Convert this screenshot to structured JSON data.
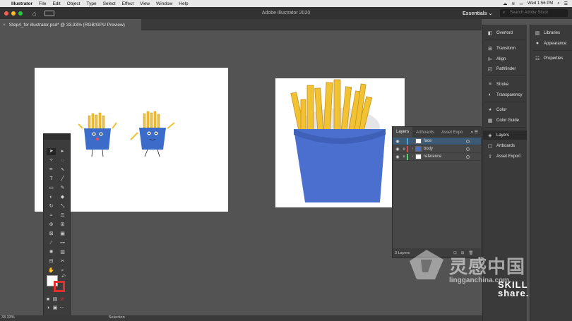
{
  "menubar": {
    "app": "Illustrator",
    "items": [
      "File",
      "Edit",
      "Object",
      "Type",
      "Select",
      "Effect",
      "View",
      "Window",
      "Help"
    ],
    "clock": "Wed 1:56 PM"
  },
  "appbar": {
    "title": "Adobe Illustrator 2020",
    "workspace": "Essentials",
    "search_placeholder": "Search Adobe Stock"
  },
  "document": {
    "tab": "Step4_for illustrator.psd* @ 33.33% (RGB/GPU Preview)"
  },
  "layers_panel": {
    "tabs": [
      "Layers",
      "Artboards",
      "Asset Expo"
    ],
    "layers": [
      {
        "name": "face",
        "color": "#4aa3d8",
        "selected": true,
        "locked": false
      },
      {
        "name": "body",
        "color": "#d84a4a",
        "selected": false,
        "locked": true
      },
      {
        "name": "reference",
        "color": "#4ad86a",
        "selected": false,
        "locked": true
      }
    ],
    "count": "3 Layers"
  },
  "dock": {
    "col1": [
      {
        "label": "Overlord",
        "icon": "overlord-icon"
      },
      {
        "label": "Transform",
        "icon": "transform-icon"
      },
      {
        "label": "Align",
        "icon": "align-icon"
      },
      {
        "label": "Pathfinder",
        "icon": "pathfinder-icon"
      },
      {
        "label": "Stroke",
        "icon": "stroke-icon"
      },
      {
        "label": "Transparency",
        "icon": "transparency-icon"
      },
      {
        "label": "Color",
        "icon": "color-icon"
      },
      {
        "label": "Color Guide",
        "icon": "color-guide-icon"
      },
      {
        "label": "Layers",
        "icon": "layers-icon"
      },
      {
        "label": "Artboards",
        "icon": "artboards-icon"
      },
      {
        "label": "Asset Export",
        "icon": "asset-export-icon"
      }
    ],
    "col2": [
      {
        "label": "Libraries",
        "icon": "libraries-icon"
      },
      {
        "label": "Appearance",
        "icon": "appearance-icon"
      },
      {
        "label": "Properties",
        "icon": "properties-icon"
      }
    ]
  },
  "status": {
    "zoom": "33.33%",
    "mode": "Selection"
  },
  "watermark": {
    "brand": "灵感中国",
    "url": "lingganchina.com",
    "skill": "SKILL",
    "share": "share."
  }
}
